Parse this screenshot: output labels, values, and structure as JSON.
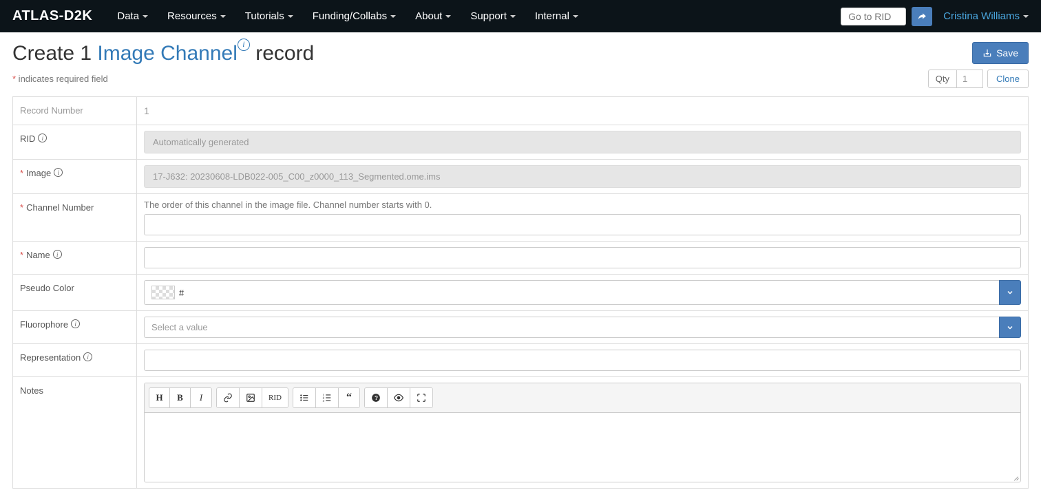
{
  "brand": "ATLAS-D2K",
  "nav": {
    "items": [
      "Data",
      "Resources",
      "Tutorials",
      "Funding/Collabs",
      "About",
      "Support",
      "Internal"
    ],
    "rid_placeholder": "Go to RID",
    "user": "Cristina Williams"
  },
  "header": {
    "create_prefix": "Create 1 ",
    "entity": "Image Channel",
    "record_suffix": " record",
    "save": "Save"
  },
  "subhead": {
    "req_note": " indicates required field",
    "qty_label": "Qty",
    "qty_value": "1",
    "clone": "Clone"
  },
  "labels": {
    "record_number": "Record Number",
    "rid": "RID",
    "image": "Image",
    "channel_number": "Channel Number",
    "name": "Name",
    "pseudo_color": "Pseudo Color",
    "fluorophore": "Fluorophore",
    "representation": "Representation",
    "notes": "Notes"
  },
  "values": {
    "record_number": "1",
    "rid": "Automatically generated",
    "image": "17-J632: 20230608-LDB022-005_C00_z0000_113_Segmented.ome.ims",
    "channel_hint": "The order of this channel in the image file. Channel number starts with 0.",
    "pseudo_color": "#",
    "fluorophore_placeholder": "Select a value"
  },
  "editor": {
    "rid_btn": "RID"
  }
}
